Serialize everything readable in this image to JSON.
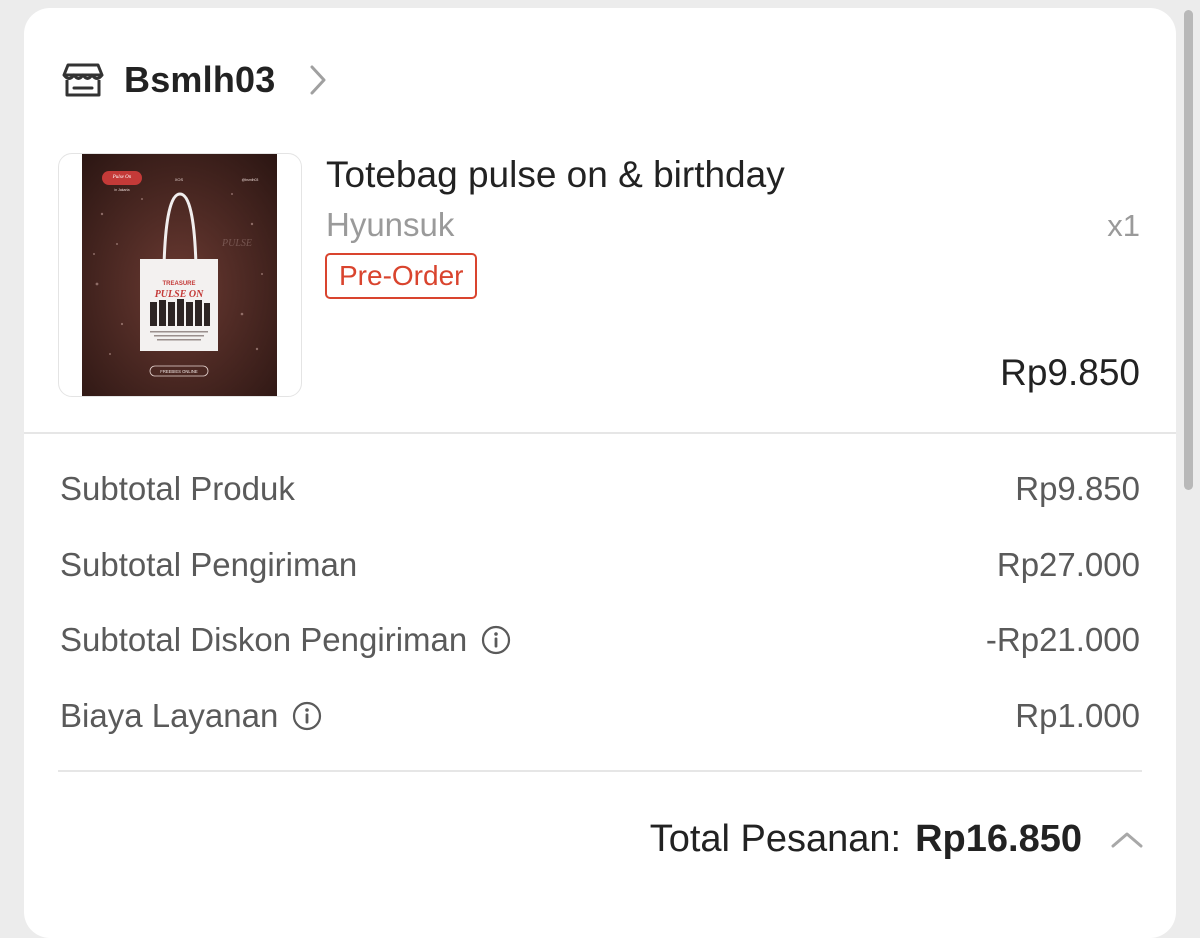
{
  "shop": {
    "name": "Bsmlh03",
    "icon": "store-icon",
    "chevron_icon": "chevron-right-icon"
  },
  "product": {
    "title": "Totebag pulse on & birthday",
    "variant": "Hyunsuk",
    "quantity": "x1",
    "badge": "Pre-Order",
    "price": "Rp9.850",
    "image_icon": "product-thumbnail",
    "image_text": {
      "banner": "Pulse On",
      "banner_sub": "in Jakarta",
      "number": "XOS",
      "handle": "@bsmlh03",
      "bag_line1": "TREASURE",
      "bag_line2": "PULSE ON",
      "bg_text": "PULSE",
      "footer": "FREEBIES ONLINE"
    }
  },
  "summary": [
    {
      "label": "Subtotal Produk",
      "value": "Rp9.850",
      "info": false
    },
    {
      "label": "Subtotal Pengiriman",
      "value": "Rp27.000",
      "info": false
    },
    {
      "label": "Subtotal Diskon Pengiriman",
      "value": "-Rp21.000",
      "info": true
    },
    {
      "label": "Biaya Layanan",
      "value": "Rp1.000",
      "info": true
    }
  ],
  "total": {
    "label": "Total Pesanan:",
    "value": "Rp16.850",
    "chevron_icon": "chevron-up-icon"
  },
  "colors": {
    "accent": "#d9442e",
    "text_primary": "#222222",
    "text_secondary": "#5a5a5a",
    "text_muted": "#9a9a9a"
  }
}
